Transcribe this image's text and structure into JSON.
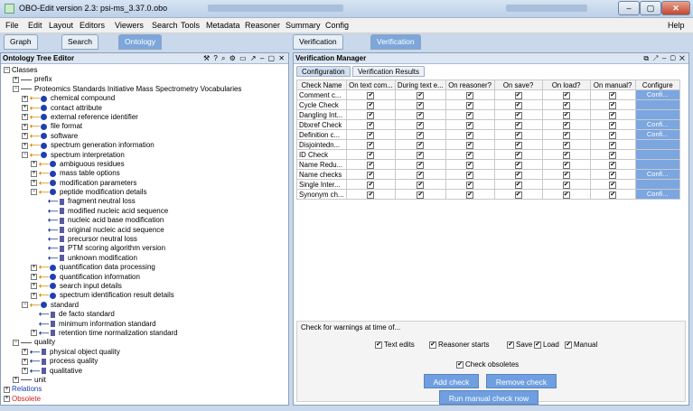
{
  "window": {
    "title": "OBO-Edit version 2.3: psi-ms_3.37.0.obo",
    "controls": {
      "minimize": "‒",
      "maximize": "▢",
      "close": "✕"
    }
  },
  "menubar": [
    "File",
    "Edit",
    "Layout",
    "Editors",
    "Viewers",
    "Search",
    "Tools",
    "Metadata",
    "Reasoner",
    "Summary",
    "Config",
    "Help"
  ],
  "left_tabs": [
    "Graph Editor",
    "Search Panel",
    "Ontology Tree Editor"
  ],
  "right_tabs": [
    "Verification Manager",
    "Verification Manager"
  ],
  "tree_panel": {
    "title": "Ontology Tree Editor",
    "controls": "⚒ ? ⌕ ⚙ ▭ ↗ ‒ ▢ ✕",
    "nodes": [
      {
        "label": "Classes",
        "exp": "−",
        "style": "root"
      },
      {
        "label": "prefix",
        "exp": "+",
        "style": "line",
        "indent": 1
      },
      {
        "label": "Proteomics Standards Initiative Mass Spectrometry Vocabularies",
        "exp": "−",
        "style": "line",
        "indent": 1
      },
      {
        "label": "chemical compound",
        "exp": "+",
        "style": "cls",
        "indent": 2
      },
      {
        "label": "contact attribute",
        "exp": "+",
        "style": "cls",
        "indent": 2
      },
      {
        "label": "external reference identifier",
        "exp": "+",
        "style": "cls",
        "indent": 2
      },
      {
        "label": "file format",
        "exp": "+",
        "style": "cls",
        "indent": 2
      },
      {
        "label": "software",
        "exp": "+",
        "style": "cls",
        "indent": 2
      },
      {
        "label": "spectrum generation information",
        "exp": "+",
        "style": "cls",
        "indent": 2
      },
      {
        "label": "spectrum interpretation",
        "exp": "−",
        "style": "cls",
        "indent": 2
      },
      {
        "label": "ambiguous residues",
        "exp": "+",
        "style": "cls",
        "indent": 3
      },
      {
        "label": "mass table options",
        "exp": "+",
        "style": "cls",
        "indent": 3
      },
      {
        "label": "modification parameters",
        "exp": "+",
        "style": "cls",
        "indent": 3
      },
      {
        "label": "peptide modification details",
        "exp": "−",
        "style": "cls",
        "indent": 3
      },
      {
        "label": "fragment neutral loss",
        "exp": "",
        "style": "ins",
        "indent": 4
      },
      {
        "label": "modified nucleic acid sequence",
        "exp": "",
        "style": "ins",
        "indent": 4
      },
      {
        "label": "nucleic acid base modification",
        "exp": "",
        "style": "ins",
        "indent": 4
      },
      {
        "label": "original nucleic acid sequence",
        "exp": "",
        "style": "ins",
        "indent": 4
      },
      {
        "label": "precursor neutral loss",
        "exp": "",
        "style": "ins",
        "indent": 4
      },
      {
        "label": "PTM scoring algorithm version",
        "exp": "",
        "style": "ins",
        "indent": 4
      },
      {
        "label": "unknown modification",
        "exp": "",
        "style": "ins",
        "indent": 4
      },
      {
        "label": "quantification data processing",
        "exp": "+",
        "style": "cls",
        "indent": 3
      },
      {
        "label": "quantification information",
        "exp": "+",
        "style": "cls",
        "indent": 3
      },
      {
        "label": "search input details",
        "exp": "+",
        "style": "cls",
        "indent": 3
      },
      {
        "label": "spectrum identification result details",
        "exp": "+",
        "style": "cls",
        "indent": 3
      },
      {
        "label": "standard",
        "exp": "−",
        "style": "cls",
        "indent": 2
      },
      {
        "label": "de facto standard",
        "exp": "",
        "style": "ins",
        "indent": 3
      },
      {
        "label": "minimum information standard",
        "exp": "",
        "style": "ins",
        "indent": 3
      },
      {
        "label": "retention time normalization standard",
        "exp": "+",
        "style": "ins",
        "indent": 3
      },
      {
        "label": "quality",
        "exp": "−",
        "style": "line",
        "indent": 1
      },
      {
        "label": "physical object quality",
        "exp": "+",
        "style": "ins",
        "indent": 2
      },
      {
        "label": "process quality",
        "exp": "+",
        "style": "ins",
        "indent": 2
      },
      {
        "label": "qualitative",
        "exp": "+",
        "style": "ins",
        "indent": 2
      },
      {
        "label": "unit",
        "exp": "+",
        "style": "line",
        "indent": 1
      },
      {
        "label": "Relations",
        "exp": "+",
        "style": "root-link"
      },
      {
        "label": "Obsolete",
        "exp": "+",
        "style": "root-obs"
      }
    ]
  },
  "verification_panel": {
    "title": "Verification Manager",
    "controls": "⧉ ↗ ‒ ▢ ✕",
    "subtabs": [
      "Configuration",
      "Verification Results"
    ],
    "columns": [
      "Check Name",
      "On text com...",
      "During text e...",
      "On reasoner?",
      "On save?",
      "On load?",
      "On manual?",
      "Configure"
    ],
    "rows": [
      {
        "name": "Comment c...",
        "configure": "Confi..."
      },
      {
        "name": "Cycle Check",
        "configure": ""
      },
      {
        "name": "Dangling Int...",
        "configure": ""
      },
      {
        "name": "Dbxref Check",
        "configure": "Confi..."
      },
      {
        "name": "Definition c...",
        "configure": "Confi..."
      },
      {
        "name": "Disjointedn...",
        "configure": ""
      },
      {
        "name": "ID Check",
        "configure": ""
      },
      {
        "name": "Name Redu...",
        "configure": ""
      },
      {
        "name": "Name checks",
        "configure": "Confi..."
      },
      {
        "name": "Single Inter...",
        "configure": ""
      },
      {
        "name": "Synonym ch...",
        "configure": "Confi..."
      }
    ],
    "check_mark": "✔",
    "warnings_label": "Check for warnings at time of...",
    "options": [
      "Text edits",
      "Reasoner starts",
      "Save",
      "Load",
      "Manual"
    ],
    "check_obsoletes": "Check obsoletes",
    "add_check": "Add check",
    "remove_check": "Remove check",
    "run_manual": "Run manual check now"
  }
}
